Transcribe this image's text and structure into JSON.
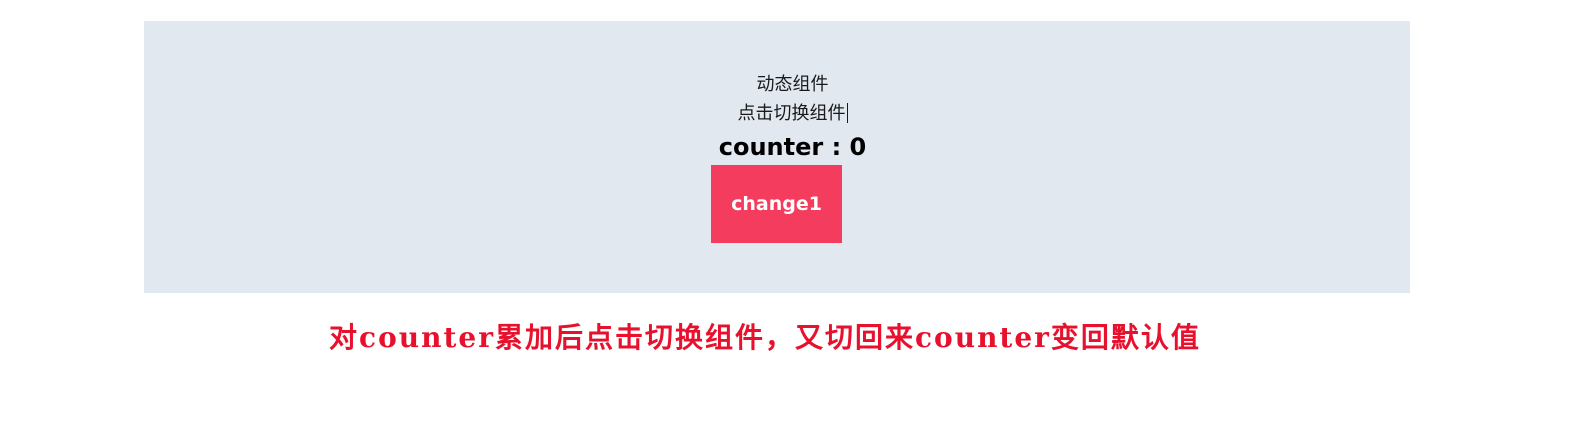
{
  "demo": {
    "title": "动态组件",
    "subtitle": "点击切换组件",
    "counter_label": "counter : 0",
    "button_label": "change1"
  },
  "annotation": {
    "text": "对counter累加后点击切换组件，又切回来counter变回默认值"
  },
  "colors": {
    "panel_background": "#e1e8f0",
    "button_background": "#f43d5e",
    "button_text": "#ffffff",
    "annotation_text": "#e8112d"
  }
}
